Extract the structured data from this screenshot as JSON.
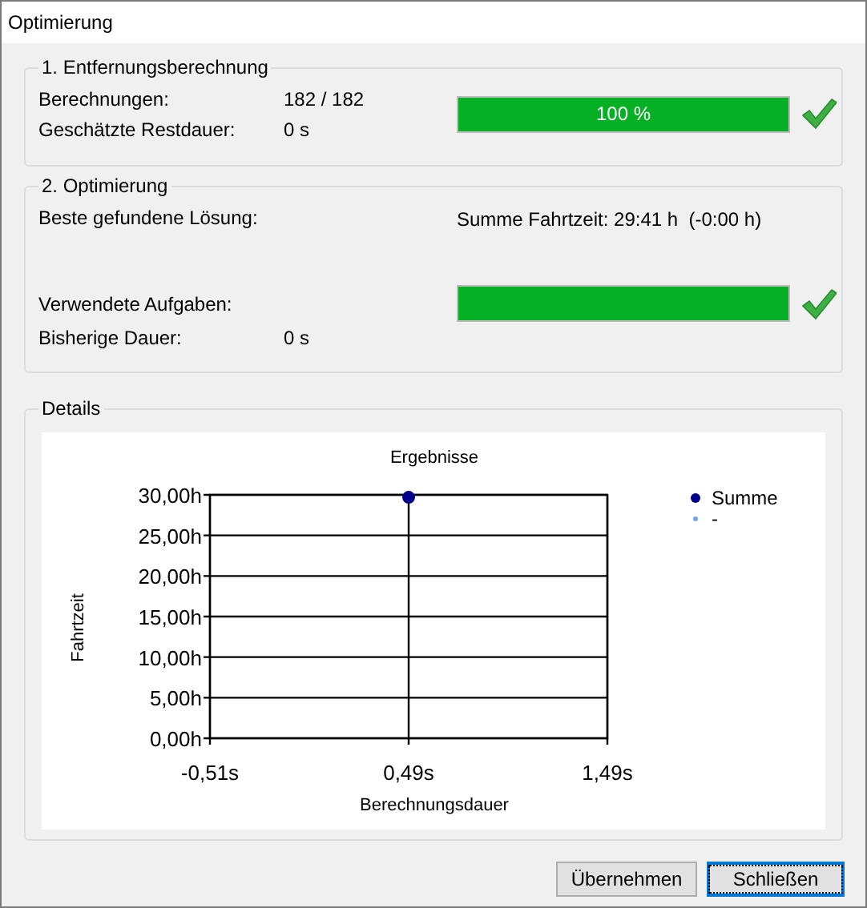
{
  "window": {
    "title": "Optimierung"
  },
  "distance_section": {
    "title": "1. Entfernungsberechnung",
    "rows": [
      {
        "label": "Berechnungen:",
        "value": "182 / 182"
      },
      {
        "label": "Geschätzte Restdauer:",
        "value": "0 s"
      }
    ],
    "progress": {
      "level": 1,
      "text": "100 %",
      "done": true
    }
  },
  "optimization_section": {
    "title": "2. Optimierung",
    "best_label": "Beste gefundene Lösung:",
    "best_value": "Summe Fahrtzeit: 29:41 h  (-0:00 h)",
    "tasks_label": "Verwendete Aufgaben:",
    "duration_label": "Bisherige Dauer:",
    "duration_value": "0 s",
    "progress": {
      "level": 1,
      "done": true
    }
  },
  "details": {
    "title": "Details",
    "chart_data": {
      "type": "scatter",
      "title": "Ergebnisse",
      "xlabel": "Berechnungsdauer",
      "ylabel": "Fahrtzeit",
      "x": [
        0.49
      ],
      "series": [
        {
          "name": "Summe",
          "color": "#00008b",
          "values": [
            29.7
          ]
        },
        {
          "name": "-",
          "color": "#6fa8f0",
          "values": [
            null
          ]
        }
      ],
      "grid": true,
      "xlim": [
        -0.51,
        1.49
      ],
      "ylim": [
        0,
        30
      ],
      "xticks": [
        {
          "value": -0.51,
          "label": "-0,51s"
        },
        {
          "value": 0.49,
          "label": "0,49s"
        },
        {
          "value": 1.49,
          "label": "1,49s"
        }
      ],
      "yticks": [
        {
          "value": 0,
          "label": "0,00h"
        },
        {
          "value": 5,
          "label": "5,00h"
        },
        {
          "value": 10,
          "label": "10,00h"
        },
        {
          "value": 15,
          "label": "15,00h"
        },
        {
          "value": 20,
          "label": "20,00h"
        },
        {
          "value": 25,
          "label": "25,00h"
        },
        {
          "value": 30,
          "label": "30,00h"
        }
      ]
    }
  },
  "buttons": [
    {
      "label": "Übernehmen",
      "focused": false
    },
    {
      "label": "Schließen",
      "focused": true
    }
  ]
}
